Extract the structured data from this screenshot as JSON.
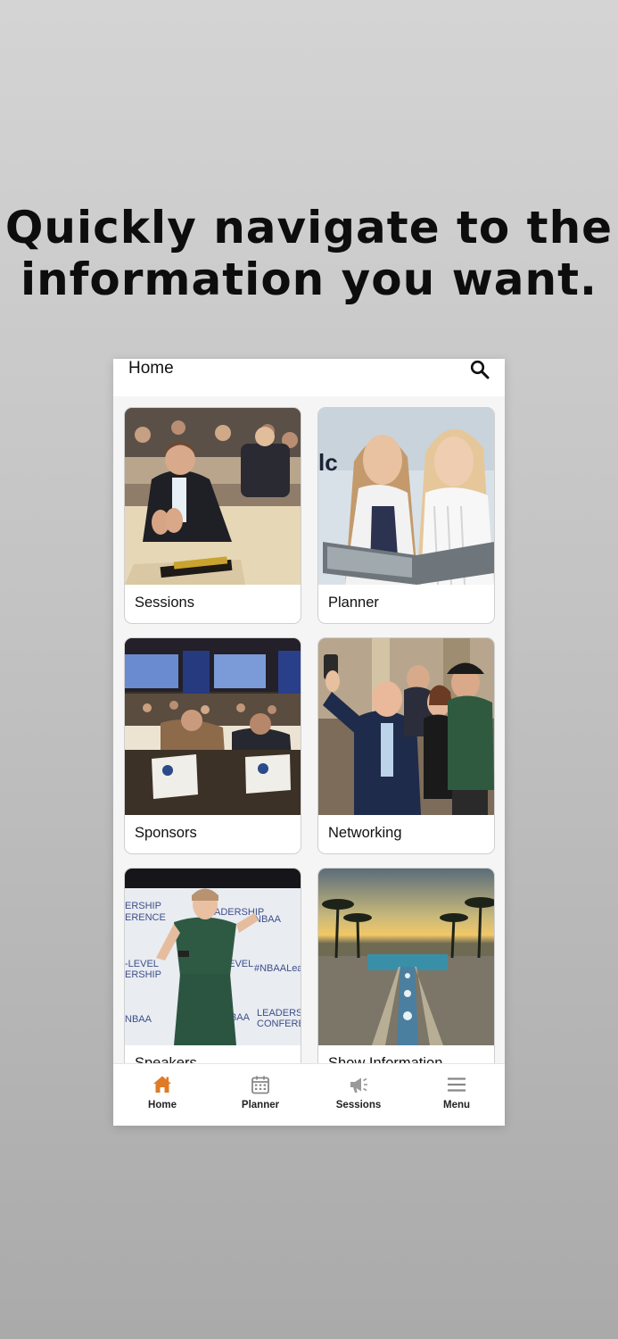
{
  "headline": {
    "line1": "Quickly navigate to the",
    "line2": "information you want."
  },
  "app": {
    "title": "Home",
    "accent_color": "#e07a26",
    "icons": {
      "search": "search-icon"
    }
  },
  "tiles": [
    {
      "label": "Sessions",
      "image": "photo of conference attendees applauding"
    },
    {
      "label": "Planner",
      "image": "photo of two women reading a brochure"
    },
    {
      "label": "Sponsors",
      "image": "photo of conference ballroom with screens"
    },
    {
      "label": "Networking",
      "image": "photo of group taking selfie"
    },
    {
      "label": "Speakers",
      "image": "photo of speaker on stage"
    },
    {
      "label": "Show Information",
      "image": "photo of resort fountain at sunset"
    }
  ],
  "tabbar": {
    "items": [
      {
        "label": "Home",
        "icon": "home-icon",
        "active": true
      },
      {
        "label": "Planner",
        "icon": "calendar-icon",
        "active": false
      },
      {
        "label": "Sessions",
        "icon": "megaphone-icon",
        "active": false
      },
      {
        "label": "Menu",
        "icon": "menu-icon",
        "active": false
      }
    ]
  }
}
